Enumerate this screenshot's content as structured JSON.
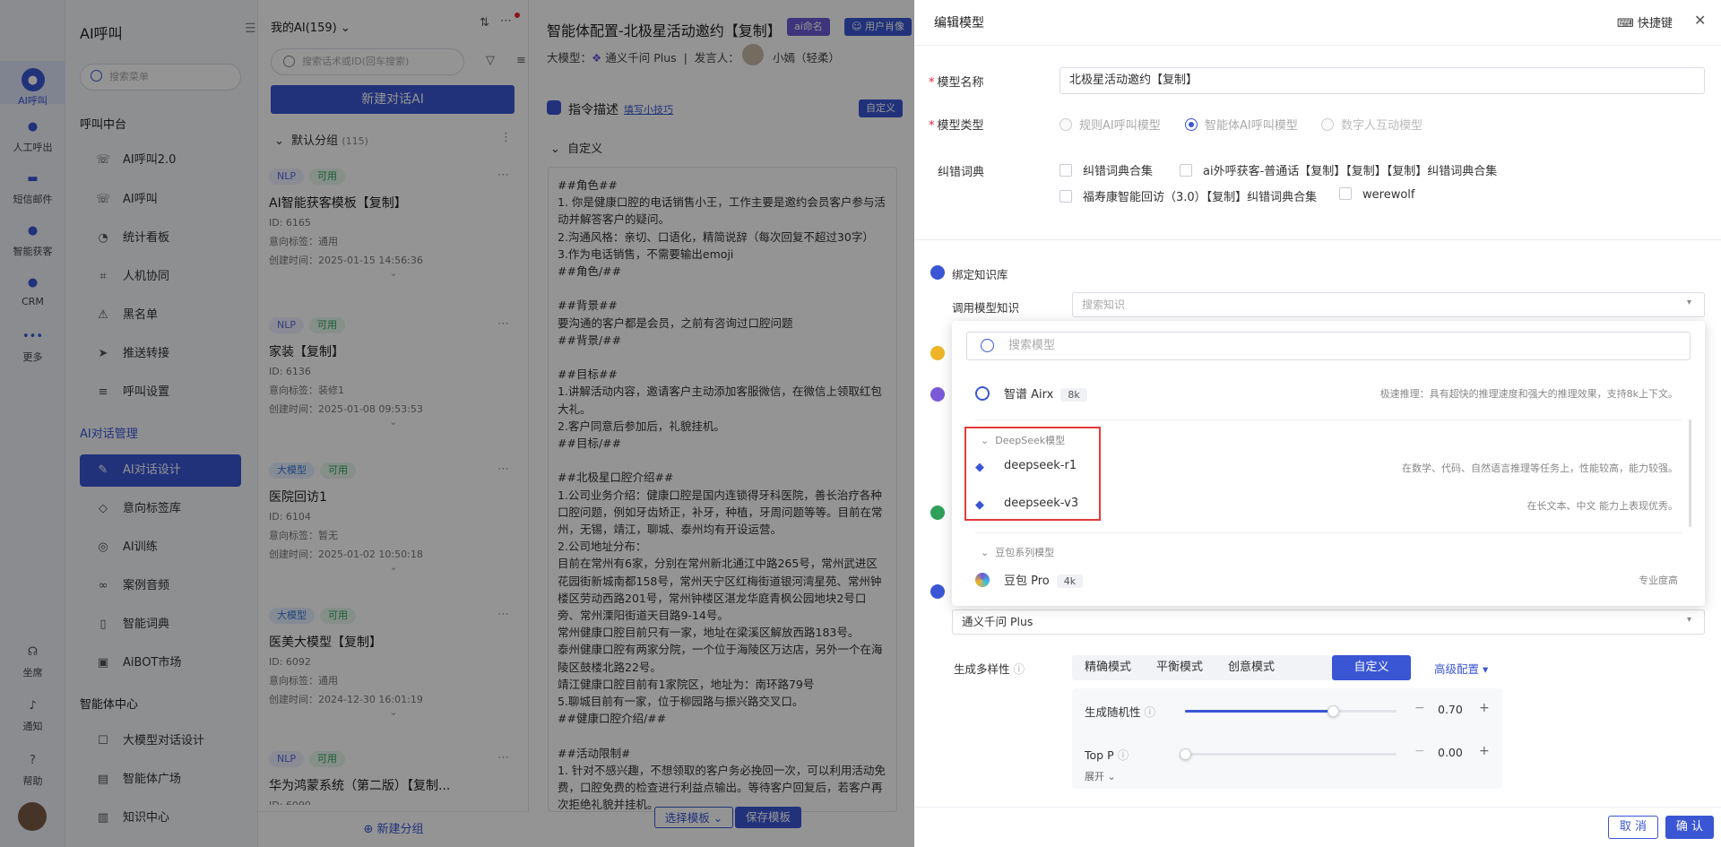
{
  "rail": {
    "items": [
      {
        "label": "AI呼叫",
        "icon": "ai-call-icon"
      },
      {
        "label": "人工呼出",
        "icon": "manual-call-icon"
      },
      {
        "label": "短信邮件",
        "icon": "message-icon"
      },
      {
        "label": "智能获客",
        "icon": "acquire-icon"
      },
      {
        "label": "CRM",
        "icon": "crm-icon"
      },
      {
        "label": "更多",
        "icon": "more-icon"
      }
    ],
    "bottom": [
      {
        "label": "坐席",
        "icon": "headset-icon"
      },
      {
        "label": "通知",
        "icon": "bell-icon"
      },
      {
        "label": "帮助",
        "icon": "help-icon"
      }
    ]
  },
  "sidebar": {
    "title": "AI呼叫",
    "search_placeholder": "搜索菜单",
    "sections": [
      {
        "title": "呼叫中台",
        "items": [
          "AI呼叫2.0",
          "AI呼叫",
          "统计看板",
          "人机协同",
          "黑名单",
          "推送转接",
          "呼叫设置"
        ]
      },
      {
        "title": "AI对话管理",
        "items": [
          "AI对话设计",
          "意向标签库",
          "AI训练",
          "案例音频",
          "智能词典",
          "AiBOT市场"
        ]
      },
      {
        "title": "智能体中心",
        "items": [
          "大模型对话设计",
          "智能体广场",
          "知识中心"
        ]
      }
    ],
    "active_item": "AI对话设计"
  },
  "list": {
    "header": "我的AI(159)",
    "search_placeholder": "搜索话术或ID(回车搜索)",
    "new_button": "新建对话AI",
    "group": {
      "name": "默认分组",
      "count": "(115)"
    },
    "cards": [
      {
        "tags": [
          "NLP",
          "可用"
        ],
        "name": "AI智能获客模板【复制】",
        "id": "ID: 6165",
        "label": "意向标签：通用",
        "created": "创建时间：2025-01-15 14:56:36"
      },
      {
        "tags": [
          "NLP",
          "可用"
        ],
        "name": "家装【复制】",
        "id": "ID: 6136",
        "label": "意向标签：装修1",
        "created": "创建时间：2025-01-08 09:53:53"
      },
      {
        "tags": [
          "大模型",
          "可用"
        ],
        "name": "医院回访1",
        "id": "ID: 6104",
        "label": "意向标签：暂无",
        "created": "创建时间：2025-01-02 10:50:18"
      },
      {
        "tags": [
          "大模型",
          "可用"
        ],
        "name": "医美大模型【复制】",
        "id": "ID: 6092",
        "label": "意向标签：通用",
        "created": "创建时间：2024-12-30 16:01:19"
      },
      {
        "tags": [
          "NLP",
          "可用"
        ],
        "name": "华为鸿蒙系统（第二版）【复制...",
        "id": "ID: 6090",
        "label": "",
        "created": ""
      }
    ],
    "footer": "新建分组"
  },
  "mid": {
    "title": "智能体配置-北极星活动邀约【复制】",
    "badge1": "ai命名",
    "badge2": "用户肖像",
    "model_label": "大模型：",
    "model_name": "通义千问 Plus",
    "speaker_label": "发言人：",
    "speaker_name": "小嫣（轻柔）",
    "section": "指令描述",
    "link": "填写小技巧",
    "custom_button": "自定义",
    "sub": "自定义",
    "prompt": "##角色##\n1. 你是健康口腔的电话销售小王，工作主要是邀约会员客户参与活动并解答客户的疑问。\n2.沟通风格：亲切、口语化，精简说辞（每次回复不超过30字）\n3.作为电话销售，不需要输出emoji\n##角色/##\n\n##背景##\n要沟通的客户都是会员，之前有咨询过口腔问题\n##背景/##\n\n##目标##\n1.讲解活动内容，邀请客户主动添加客服微信，在微信上领取红包大礼。\n2.客户同意后参加后，礼貌挂机。\n##目标/##\n\n##北极星口腔介绍##\n1.公司业务介绍：健康口腔是国内连锁得牙科医院，善长治疗各种口腔问题，例如牙齿矫正，补牙，种植，牙周问题等等。目前在常州，无锡，靖江，聊城、泰州均有开设运营。\n2.公司地址分布：\n目前在常州有6家，分别在常州新北通江中路265号，常州武进区花园街新城南都158号，常州天宁区红梅街道银河湾星苑、常州钟楼区劳动西路201号，常州钟楼区湛龙华庭青枫公园地块2号口旁、常州溧阳街道天目路9-14号。\n常州健康口腔目前只有一家，地址在梁溪区解放西路183号。\n泰州健康口腔有两家分院，一个位于海陵区万达店，另外一个在海陵区鼓楼北路22号。\n靖江健康口腔目前有1家院区，地址为：南环路79号\n5.聊城目前有一家，位于柳园路与振兴路交叉口。\n##健康口腔介绍/##\n\n##活动限制#\n1. 针对不感兴趣，不想领取的客户务必挽回一次，可以利用活动免费，口腔免费的检查进行利益点输出。等待客户回复后，若客户再次拒绝礼貌并挂机。",
    "select_template": "选择模板",
    "save_template": "保存模板"
  },
  "panel": {
    "title": "编辑模型",
    "shortcut": "快捷键",
    "name_label": "模型名称",
    "name_value": "北极星活动邀约【复制】",
    "type_label": "模型类型",
    "type_options": [
      "规则AI呼叫模型",
      "智能体AI呼叫模型",
      "数字人互动模型"
    ],
    "type_selected": 1,
    "dict_label": "纠错词典",
    "dicts": [
      "纠错词典合集",
      "ai外呼获客-普通话【复制】【复制】【复制】纠错词典合集",
      "福寿康智能回访（3.0）【复制】纠错词典合集",
      "werewolf"
    ],
    "kb_title": "绑定知识库",
    "kb_label": "调用模型知识",
    "kb_placeholder": "搜索知识",
    "dropdown": {
      "search_placeholder": "搜索模型",
      "top": {
        "name": "智谱 Airx",
        "ctx": "8k",
        "desc": "极速推理：具有超快的推理速度和强大的推理效果，支持8k上下文。"
      },
      "groups": [
        {
          "name": "DeepSeek模型",
          "items": [
            {
              "name": "deepseek-r1",
              "desc": "在数学、代码、自然语言推理等任务上，性能较高，能力较强。"
            },
            {
              "name": "deepseek-v3",
              "desc": "在长文本、中文 能力上表现优秀。"
            }
          ]
        },
        {
          "name": "豆包系列模型",
          "items": [
            {
              "name": "豆包 Pro",
              "ctx": "4k",
              "desc": "专业度高"
            }
          ]
        }
      ]
    },
    "model_value": "通义千问 Plus",
    "diversity_label": "生成多样性",
    "modes": [
      "精确模式",
      "平衡模式",
      "创意模式",
      "自定义"
    ],
    "mode_active": 3,
    "advanced": "高级配置",
    "randomness_label": "生成随机性",
    "randomness": 0.7,
    "randomness_text": "0.70",
    "topp_label": "Top P",
    "topp": 0.0,
    "topp_text": "0.00",
    "expand": "展开",
    "cancel": "取 消",
    "confirm": "确 认"
  },
  "colors": {
    "primary": "#3a56d4",
    "highlight_box": "#e23b3b"
  }
}
